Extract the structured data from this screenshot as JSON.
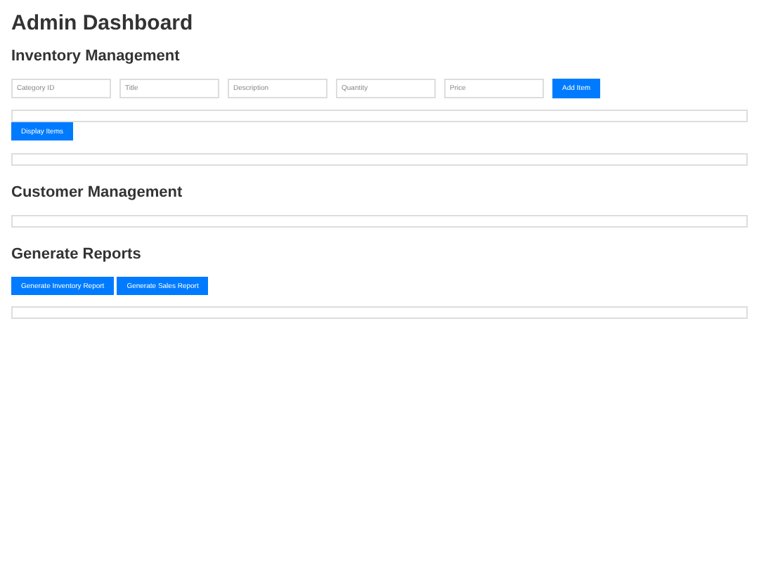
{
  "title": "Admin Dashboard",
  "inventory": {
    "heading": "Inventory Management",
    "fields": [
      {
        "placeholder": "Category ID"
      },
      {
        "placeholder": "Title"
      },
      {
        "placeholder": "Description"
      },
      {
        "placeholder": "Quantity"
      },
      {
        "placeholder": "Price"
      }
    ],
    "add_button": "Add Item",
    "display_button": "Display Items"
  },
  "customers": {
    "heading": "Customer Management"
  },
  "reports": {
    "heading": "Generate Reports",
    "buttons": [
      "Generate Inventory Report",
      "Generate Sales Report"
    ]
  }
}
